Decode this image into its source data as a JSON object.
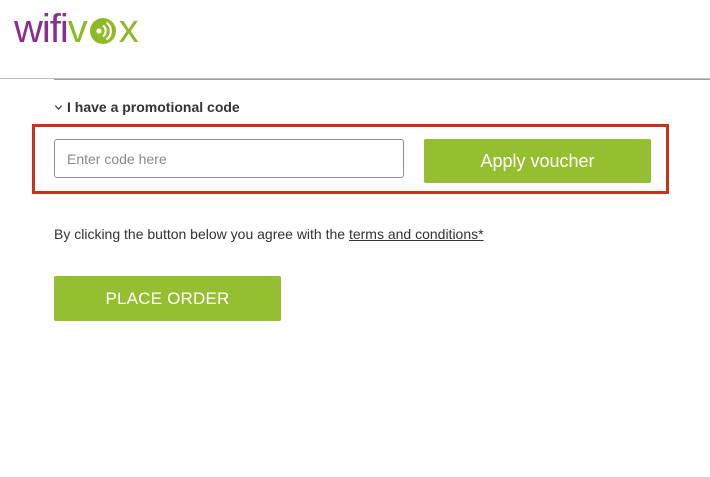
{
  "brand": {
    "logo_text_a": "wifi",
    "logo_text_b": "v",
    "logo_text_c": "x",
    "colors": {
      "purple": "#8b2f8f",
      "green": "#8dbb26"
    }
  },
  "promo": {
    "toggle_label": "I have a promotional code",
    "toggle_icon": "chevron-down-icon",
    "input_placeholder": "Enter code here",
    "input_value": "",
    "apply_label": "Apply voucher"
  },
  "terms": {
    "prefix": "By clicking the button below you agree with the ",
    "link_text": "terms and conditions*"
  },
  "order": {
    "place_label": "PLACE ORDER"
  },
  "colors": {
    "button_green": "#95bf30",
    "highlight_red": "#c8321c"
  }
}
